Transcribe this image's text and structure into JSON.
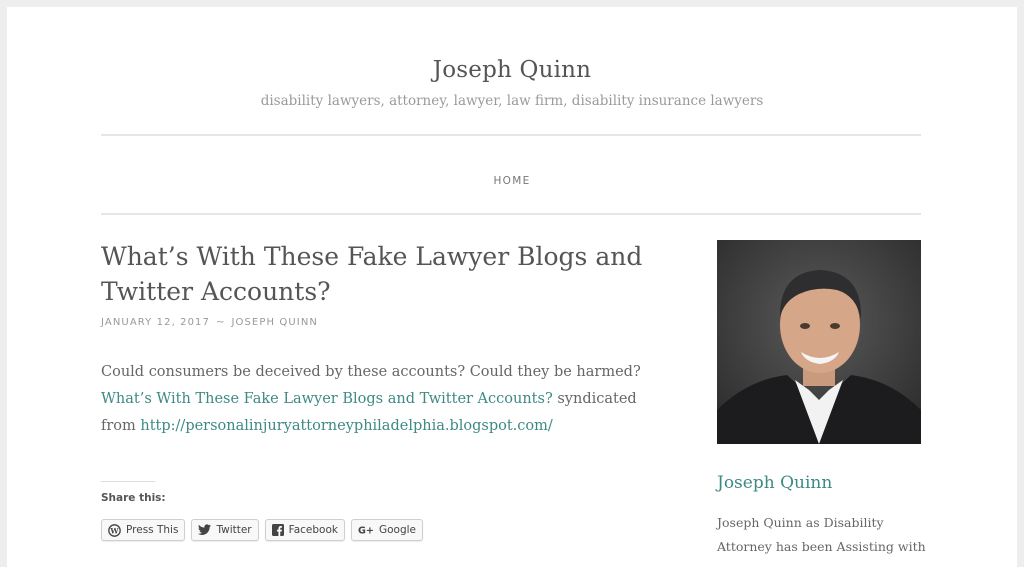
{
  "header": {
    "site_title": "Joseph Quinn",
    "tagline": "disability lawyers, attorney, lawyer, law firm, disability insurance lawyers"
  },
  "nav": {
    "items": [
      {
        "label": "HOME"
      }
    ]
  },
  "post": {
    "title": "What’s With These Fake Lawyer Blogs and Twitter Accounts?",
    "date": "JANUARY 12, 2017",
    "separator": "~",
    "author": "JOSEPH QUINN",
    "body_text_1": "Could consumers be deceived by these accounts? Could they be harmed?",
    "body_link_1": "What’s With These Fake Lawyer Blogs and Twitter Accounts?",
    "body_text_2": " syndicated from ",
    "body_link_2": "http://personalinjuryattorneyphiladelphia.blogspot.com/"
  },
  "share": {
    "label": "Share this:",
    "buttons": [
      {
        "label": "Press This",
        "icon": "wordpress-icon"
      },
      {
        "label": "Twitter",
        "icon": "twitter-icon"
      },
      {
        "label": "Facebook",
        "icon": "facebook-icon"
      },
      {
        "label": "Google",
        "icon": "google-plus-icon"
      }
    ]
  },
  "sidebar": {
    "name": "Joseph Quinn",
    "bio": "Joseph Quinn as Disability Attorney has been Assisting with"
  },
  "colors": {
    "accent": "#3d8a85",
    "background": "#eeeeee",
    "page": "#ffffff"
  }
}
